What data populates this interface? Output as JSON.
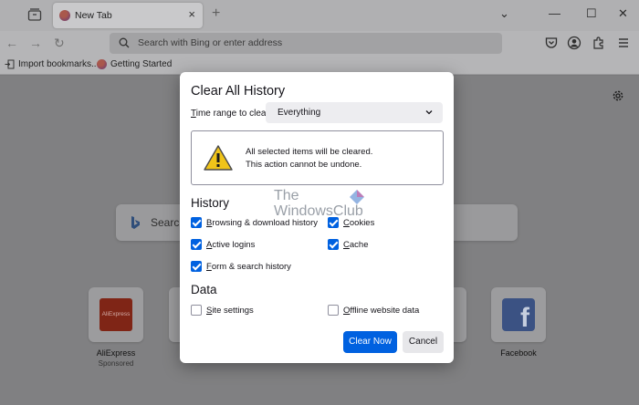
{
  "browser": {
    "tab": {
      "title": "New Tab",
      "close_glyph": "×"
    },
    "new_tab_glyph": "+",
    "window_controls": {
      "list_all_tabs": "⌄",
      "minimize": "—",
      "maximize": "☐",
      "close": "✕"
    },
    "nav": {
      "back": "←",
      "forward": "→",
      "reload": "↻"
    },
    "address_placeholder": "Search with Bing or enter address",
    "bookmarks": [
      {
        "label": "Import bookmarks...",
        "icon": "import-icon"
      },
      {
        "label": "Getting Started",
        "icon": "firefox-icon"
      }
    ],
    "toolbar_icons": [
      "pocket-icon",
      "account-icon",
      "extensions-icon",
      "menu-icon"
    ]
  },
  "newtab": {
    "search_placeholder": "Search",
    "top_sites": [
      {
        "name": "AliExpress",
        "sub": "Sponsored",
        "logo_text": "AliExpress"
      },
      {
        "name": "Facebook",
        "sub": "",
        "logo_text": "f"
      }
    ]
  },
  "watermark": {
    "line1": "The",
    "line2": "WindowsClub"
  },
  "dialog": {
    "title": "Clear All History",
    "time_range": {
      "label_access": "T",
      "label_rest": "ime range to clear:",
      "value": "Everything"
    },
    "warning": {
      "line1": "All selected items will be cleared.",
      "line2": "This action cannot be undone."
    },
    "history": {
      "heading": "History",
      "items": [
        {
          "access": "B",
          "rest": "rowsing & download history",
          "checked": true
        },
        {
          "access": "C",
          "rest": "ookies",
          "checked": true
        },
        {
          "access": "A",
          "rest": "ctive logins",
          "checked": true
        },
        {
          "access": "C",
          "rest": "ache",
          "checked": true
        },
        {
          "access": "F",
          "rest": "orm & search history",
          "checked": true
        }
      ]
    },
    "data": {
      "heading": "Data",
      "items": [
        {
          "access": "S",
          "rest": "ite settings",
          "checked": false
        },
        {
          "access": "O",
          "rest": "ffline website data",
          "checked": false
        }
      ]
    },
    "buttons": {
      "primary": "Clear Now",
      "secondary": "Cancel"
    }
  },
  "colors": {
    "accent": "#0061e0",
    "warning_yellow": "#f0c419"
  }
}
